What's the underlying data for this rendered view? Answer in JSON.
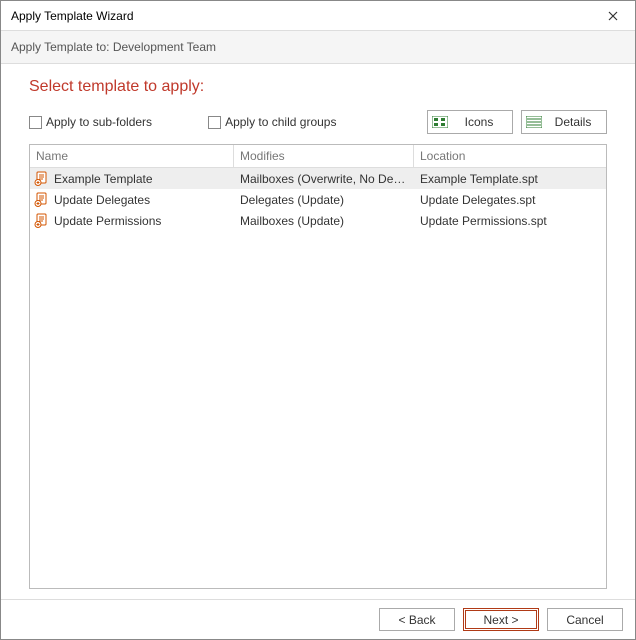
{
  "window": {
    "title": "Apply Template Wizard",
    "subtitle": "Apply Template to: Development Team"
  },
  "heading": "Select template to apply:",
  "checkboxes": {
    "sub_folders": "Apply to sub-folders",
    "child_groups": "Apply to child groups"
  },
  "view_buttons": {
    "icons": "Icons",
    "details": "Details"
  },
  "table": {
    "columns": {
      "name": "Name",
      "modifies": "Modifies",
      "location": "Location"
    },
    "rows": [
      {
        "name": "Example Template",
        "modifies": "Mailboxes (Overwrite, No Delete), …",
        "location": "Example Template.spt",
        "selected": true
      },
      {
        "name": "Update Delegates",
        "modifies": "Delegates (Update)",
        "location": "Update Delegates.spt",
        "selected": false
      },
      {
        "name": "Update Permissions",
        "modifies": "Mailboxes (Update)",
        "location": "Update Permissions.spt",
        "selected": false
      }
    ]
  },
  "footer": {
    "back": "< Back",
    "next": "Next >",
    "cancel": "Cancel"
  }
}
